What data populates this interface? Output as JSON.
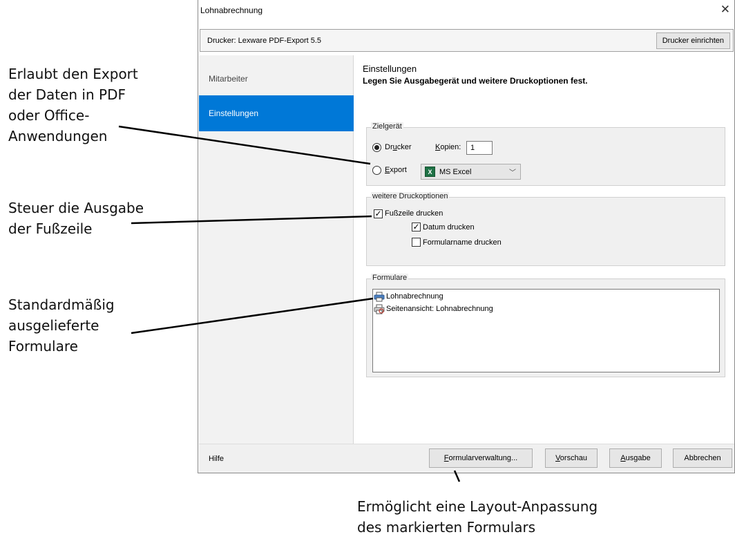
{
  "annotations": {
    "export": "Erlaubt den Export\nder Daten in PDF\noder Office-\nAnwendungen",
    "footer": "Steuer die Ausgabe\nder Fußzeile",
    "forms": "Standardmäßig\nausgelieferte\nFormulare",
    "layout": "Ermöglicht eine Layout-Anpassung\ndes markierten Formulars"
  },
  "window": {
    "title": "Lohnabrechnung"
  },
  "printer": {
    "label": "Drucker:  Lexware PDF-Export 5.5",
    "setup_button": "Drucker einrichten"
  },
  "sidebar": {
    "items": [
      {
        "label": "Mitarbeiter",
        "selected": false
      },
      {
        "label": "Einstellungen",
        "selected": true
      }
    ]
  },
  "page": {
    "heading": "Einstellungen",
    "subheading": "Legen Sie Ausgabegerät und weitere Druckoptionen fest."
  },
  "target_device": {
    "group_label": "Zielgerät",
    "printer_radio": {
      "label_pre": "Dr",
      "label_u": "u",
      "label_post": "cker",
      "selected": true
    },
    "copies_label_u": "K",
    "copies_label_rest": "opien:",
    "copies_value": "1",
    "export_radio": {
      "label_u": "E",
      "label_post": "xport",
      "selected": false
    },
    "export_format": "MS Excel",
    "export_icon": "excel-icon"
  },
  "print_options": {
    "group_label": "weitere Druckoptionen",
    "footer_checkbox": {
      "label": "Fußzeile drucken",
      "checked": true
    },
    "date_checkbox": {
      "label": "Datum drucken",
      "checked": true
    },
    "formname_checkbox": {
      "label": "Formularname drucken",
      "checked": false
    }
  },
  "forms": {
    "group_label": "Formulare",
    "items": [
      {
        "label": "Lohnabrechnung",
        "icon": "printer-icon"
      },
      {
        "label": "Seitenansicht: Lohnabrechnung",
        "icon": "print-preview-icon"
      }
    ]
  },
  "footer": {
    "help": "Hilfe",
    "form_mgmt_u": "F",
    "form_mgmt_rest": "ormularverwaltung...",
    "preview_u": "V",
    "preview_rest": "orschau",
    "output_u": "A",
    "output_rest": "usgabe",
    "cancel": "Abbrechen"
  },
  "colors": {
    "selected_sidebar": "#0078d7",
    "excel_green": "#1e7145"
  }
}
